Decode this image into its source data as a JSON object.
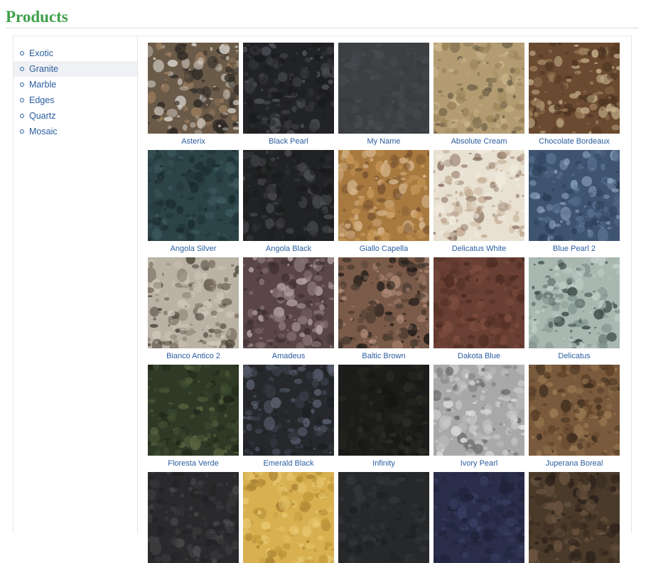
{
  "page": {
    "title": "Products"
  },
  "sidebar": {
    "items": [
      {
        "label": "Exotic",
        "active": false
      },
      {
        "label": "Granite",
        "active": true
      },
      {
        "label": "Marble",
        "active": false
      },
      {
        "label": "Edges",
        "active": false
      },
      {
        "label": "Quartz",
        "active": false
      },
      {
        "label": "Mosaic",
        "active": false
      }
    ]
  },
  "products": [
    {
      "name": "Asterix",
      "colors": [
        "#6a5a48",
        "#2e2a26",
        "#d8d4cc",
        "#a08060"
      ]
    },
    {
      "name": "Black Pearl",
      "colors": [
        "#222326",
        "#1a1b1d",
        "#3b3c40",
        "#55575c"
      ]
    },
    {
      "name": "My Name",
      "colors": [
        "#3d4043",
        "#383b3e",
        "#44474a",
        "#4a4d50"
      ]
    },
    {
      "name": "Absolute Cream",
      "colors": [
        "#b49c72",
        "#9a8358",
        "#cdb88e",
        "#6e6248"
      ]
    },
    {
      "name": "Chocolate Bordeaux",
      "colors": [
        "#6a4a30",
        "#4c3422",
        "#9a7a58",
        "#c4b08a"
      ]
    },
    {
      "name": "Angola Silver",
      "colors": [
        "#2c4448",
        "#203236",
        "#3e5a5e",
        "#1a2a2c"
      ]
    },
    {
      "name": "Angola Black",
      "colors": [
        "#212224",
        "#1a1b1c",
        "#333437",
        "#4a4b4e"
      ]
    },
    {
      "name": "Giallo Capella",
      "colors": [
        "#a87a40",
        "#c89858",
        "#7a5430",
        "#d8b890"
      ]
    },
    {
      "name": "Delicatus White",
      "colors": [
        "#e8e0d0",
        "#f2ece0",
        "#8a7060",
        "#c0a890"
      ]
    },
    {
      "name": "Blue Pearl 2",
      "colors": [
        "#3e5470",
        "#2c3e56",
        "#5a7090",
        "#8aa0b8"
      ]
    },
    {
      "name": "Bianco Antico 2",
      "colors": [
        "#bab2a4",
        "#d0c8ba",
        "#7a6e60",
        "#4a4238"
      ]
    },
    {
      "name": "Amadeus",
      "colors": [
        "#5a4648",
        "#3c2e30",
        "#8a7678",
        "#b8a8aa"
      ]
    },
    {
      "name": "Baltic Brown",
      "colors": [
        "#7a5a48",
        "#1e1a18",
        "#b08c78",
        "#4a3a30"
      ]
    },
    {
      "name": "Dakota Blue",
      "colors": [
        "#6a4034",
        "#5a3428",
        "#7e4e40",
        "#4a2a22"
      ]
    },
    {
      "name": "Delicatus",
      "colors": [
        "#a8b8b0",
        "#c4d0ca",
        "#3a4844",
        "#7e908a"
      ]
    },
    {
      "name": "Floresta Verde",
      "colors": [
        "#2e3a26",
        "#3e4c30",
        "#1e2618",
        "#5a6440"
      ]
    },
    {
      "name": "Emerald Black",
      "colors": [
        "#26282c",
        "#1c1e22",
        "#3a3e48",
        "#5a6070"
      ]
    },
    {
      "name": "Infinity",
      "colors": [
        "#1c1c1a",
        "#161614",
        "#24241f",
        "#2e2e28"
      ]
    },
    {
      "name": "Ivory Pearl",
      "colors": [
        "#a8a8a8",
        "#c8c8c8",
        "#6a6a6a",
        "#e0e0e0"
      ]
    },
    {
      "name": "Juperana Boreal",
      "colors": [
        "#7a5a3c",
        "#5a4028",
        "#9a7a52",
        "#3e2c1e"
      ]
    },
    {
      "name": "",
      "colors": [
        "#2a2a2c",
        "#222224",
        "#3a3a3c",
        "#4a4a4c"
      ]
    },
    {
      "name": "",
      "colors": [
        "#d8b050",
        "#c09838",
        "#e8c870",
        "#a88030"
      ]
    },
    {
      "name": "",
      "colors": [
        "#26282a",
        "#1e2022",
        "#34363a",
        "#2a2c2e"
      ]
    },
    {
      "name": "",
      "colors": [
        "#2a2e4a",
        "#1e2238",
        "#3a4064",
        "#222640"
      ]
    },
    {
      "name": "",
      "colors": [
        "#4a3a2a",
        "#3a2c20",
        "#6a5440",
        "#2a201a"
      ]
    }
  ]
}
